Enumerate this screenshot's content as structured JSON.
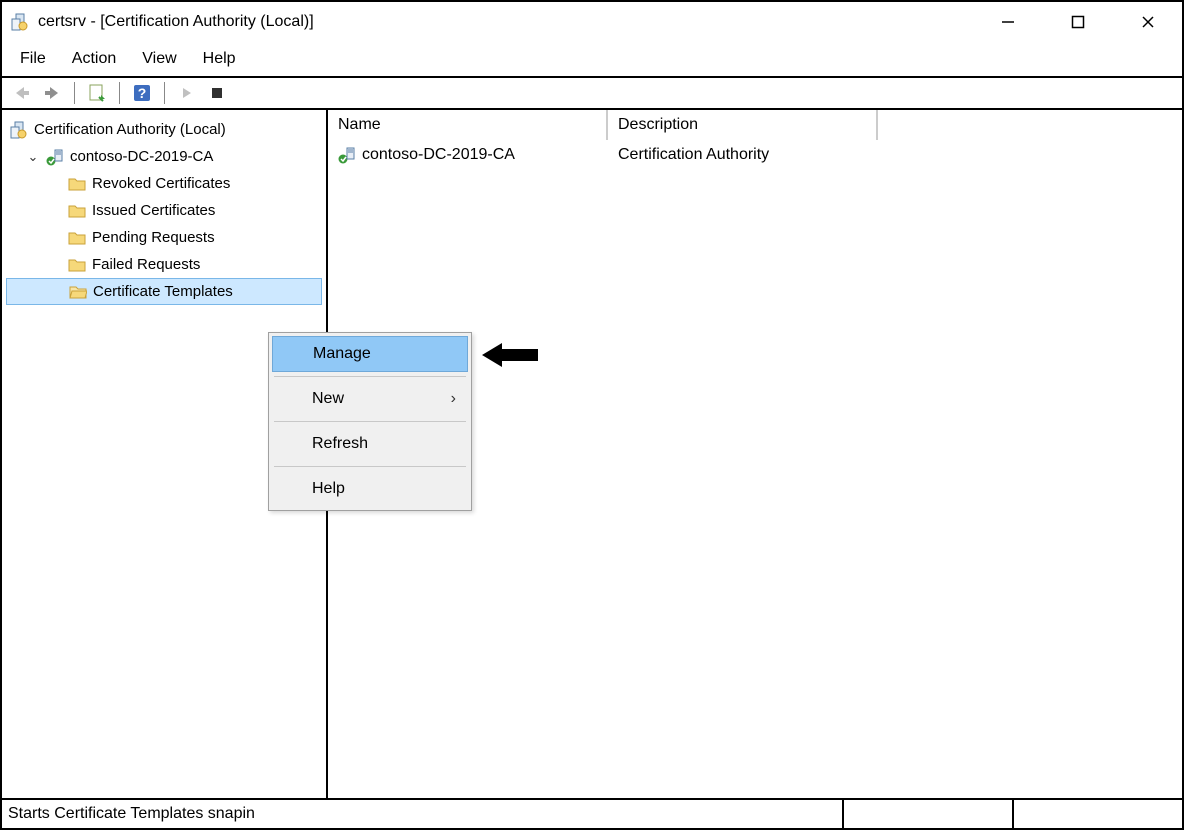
{
  "title": "certsrv - [Certification Authority (Local)]",
  "menu": {
    "file": "File",
    "action": "Action",
    "view": "View",
    "help": "Help"
  },
  "tree": {
    "root": "Certification Authority (Local)",
    "ca": "contoso-DC-2019-CA",
    "items": [
      "Revoked Certificates",
      "Issued Certificates",
      "Pending Requests",
      "Failed Requests",
      "Certificate Templates"
    ]
  },
  "columns": {
    "name": "Name",
    "desc": "Description"
  },
  "row": {
    "name": "contoso-DC-2019-CA",
    "desc": "Certification Authority"
  },
  "context": {
    "manage": "Manage",
    "new": "New",
    "refresh": "Refresh",
    "help": "Help"
  },
  "status": "Starts Certificate Templates snapin"
}
